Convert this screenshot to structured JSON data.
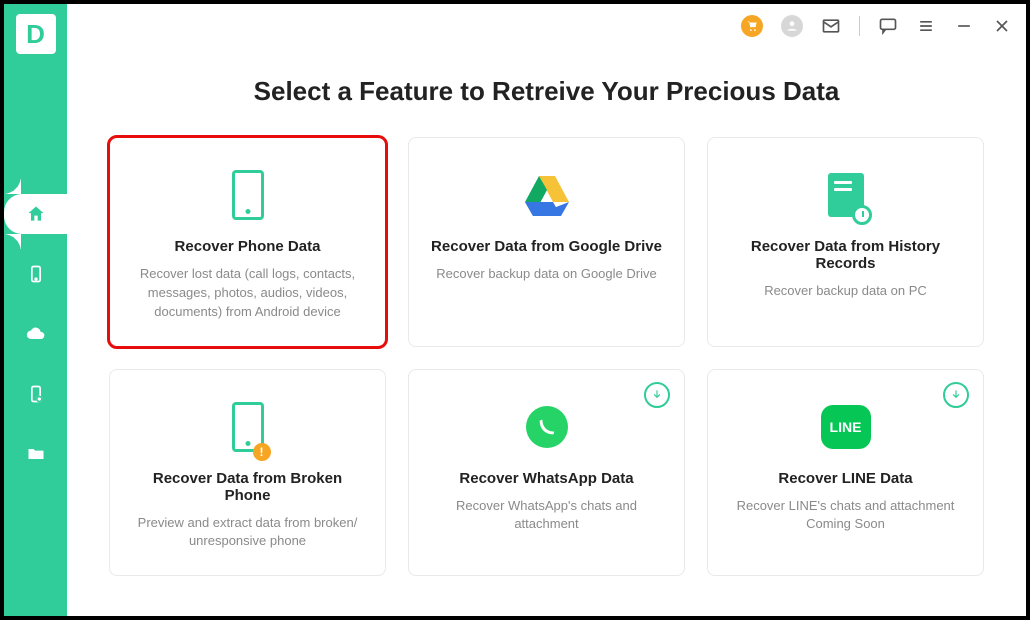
{
  "app": {
    "logo_letter": "D"
  },
  "colors": {
    "accent": "#30cc9a",
    "highlight": "#e70d0d",
    "warn": "#f6a623"
  },
  "titlebar": {
    "cart": "cart",
    "profile": "profile",
    "mail": "mail",
    "feedback": "feedback",
    "menu": "menu",
    "minimize": "minimize",
    "close": "close"
  },
  "sidebar": {
    "items": [
      {
        "name": "home",
        "active": true
      },
      {
        "name": "phone",
        "active": false
      },
      {
        "name": "cloud",
        "active": false
      },
      {
        "name": "device-restore",
        "active": false
      },
      {
        "name": "folder",
        "active": false
      }
    ]
  },
  "page": {
    "title": "Select a Feature to Retreive Your Precious Data"
  },
  "cards": [
    {
      "title": "Recover Phone Data",
      "desc": "Recover lost data (call logs, contacts, messages, photos, audios, videos, documents) from Android device",
      "icon": "phone",
      "highlighted": true
    },
    {
      "title": "Recover Data from Google Drive",
      "desc": "Recover backup data on Google Drive",
      "icon": "gdrive"
    },
    {
      "title": "Recover Data from History Records",
      "desc": "Recover backup data on PC",
      "icon": "history-doc"
    },
    {
      "title": "Recover Data from Broken Phone",
      "desc": "Preview and extract data from broken/ unresponsive phone",
      "icon": "broken-phone"
    },
    {
      "title": "Recover WhatsApp Data",
      "desc": "Recover WhatsApp's chats and attachment",
      "icon": "whatsapp",
      "downloadable": true
    },
    {
      "title": "Recover LINE Data",
      "desc": "Recover LINE's chats and attachment Coming Soon",
      "icon": "line",
      "line_text": "LINE",
      "downloadable": true
    }
  ]
}
